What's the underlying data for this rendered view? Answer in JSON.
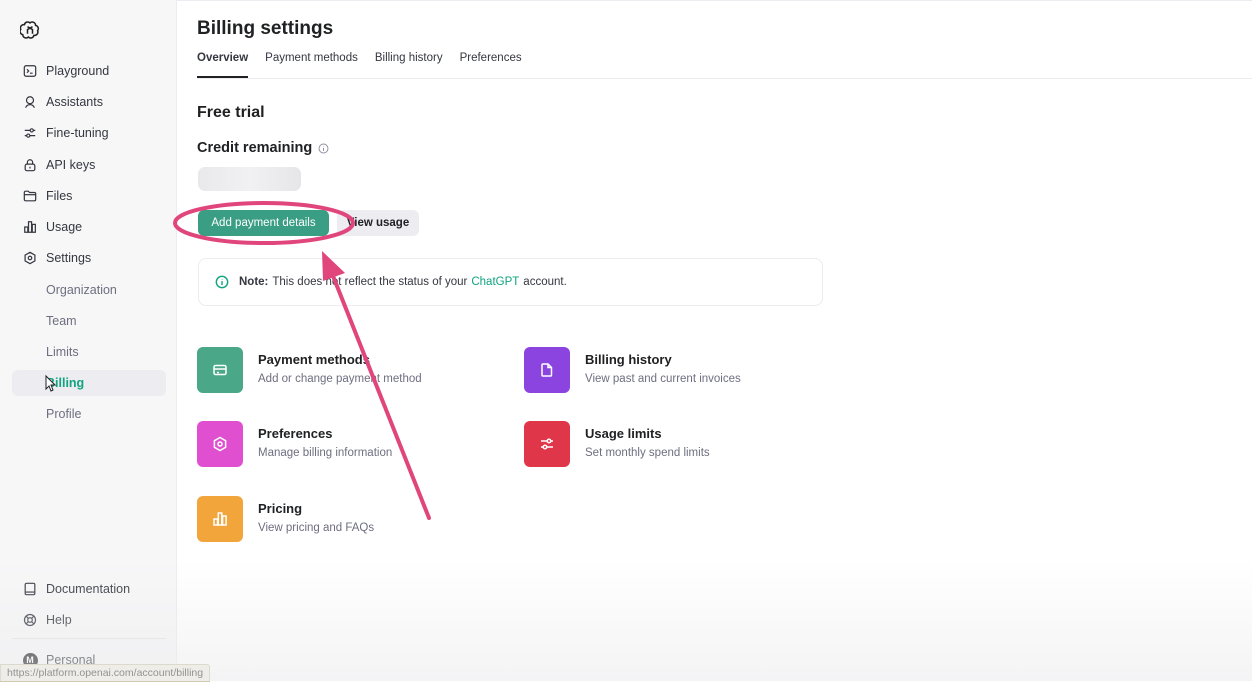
{
  "sidebar": {
    "logo_icon": "openai-logo-icon",
    "items": [
      {
        "label": "Playground",
        "icon": "terminal-icon"
      },
      {
        "label": "Assistants",
        "icon": "assistant-icon"
      },
      {
        "label": "Fine-tuning",
        "icon": "sliders-icon"
      },
      {
        "label": "API keys",
        "icon": "lock-icon"
      },
      {
        "label": "Files",
        "icon": "folder-icon"
      },
      {
        "label": "Usage",
        "icon": "bar-chart-icon"
      },
      {
        "label": "Settings",
        "icon": "gear-icon"
      }
    ],
    "settings_sub": [
      {
        "label": "Organization"
      },
      {
        "label": "Team"
      },
      {
        "label": "Limits"
      },
      {
        "label": "Billing",
        "active": true
      },
      {
        "label": "Profile"
      }
    ],
    "bottom": [
      {
        "label": "Documentation",
        "icon": "book-icon"
      },
      {
        "label": "Help",
        "icon": "lifebuoy-icon"
      }
    ],
    "account": {
      "avatar_letter": "M",
      "label": "Personal"
    }
  },
  "status_url": "https://platform.openai.com/account/billing",
  "header": {
    "title": "Billing settings",
    "tabs": [
      {
        "label": "Overview",
        "active": true
      },
      {
        "label": "Payment methods"
      },
      {
        "label": "Billing history"
      },
      {
        "label": "Preferences"
      }
    ]
  },
  "main": {
    "section_title": "Free trial",
    "credit_label": "Credit remaining",
    "add_payment_label": "Add payment details",
    "view_usage_label": "View usage",
    "note": {
      "prefix": "Note:",
      "text_before": "This does not reflect the status of your",
      "link": "ChatGPT",
      "text_after": "account."
    },
    "cards": [
      {
        "title": "Payment methods",
        "desc": "Add or change payment method",
        "color": "#4aa888",
        "icon": "credit-card-icon"
      },
      {
        "title": "Billing history",
        "desc": "View past and current invoices",
        "color": "#8b44e0",
        "icon": "document-icon"
      },
      {
        "title": "Preferences",
        "desc": "Manage billing information",
        "color": "#e04fd0",
        "icon": "gear-icon"
      },
      {
        "title": "Usage limits",
        "desc": "Set monthly spend limits",
        "color": "#e0364a",
        "icon": "sliders-icon"
      },
      {
        "title": "Pricing",
        "desc": "View pricing and FAQs",
        "color": "#f2a53b",
        "icon": "bar-chart-icon"
      }
    ]
  },
  "colors": {
    "accent": "#10a37f",
    "button": "#3a9e85",
    "annotation": "#e0457b"
  }
}
